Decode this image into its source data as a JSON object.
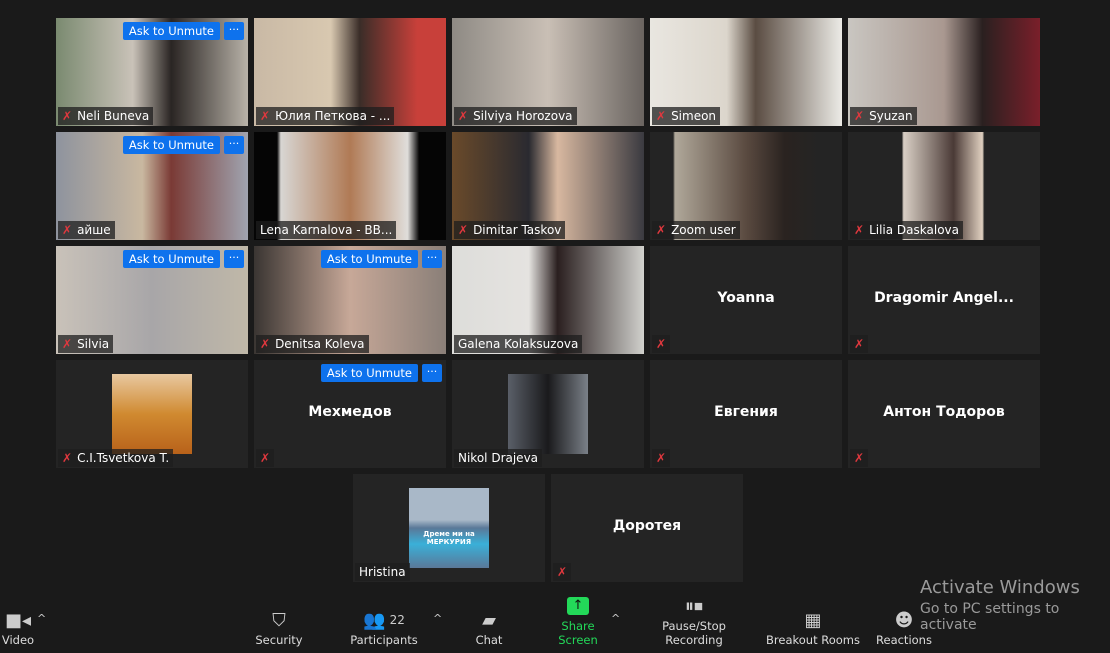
{
  "tiles": [
    {
      "name": "Neli Buneva",
      "muted": true,
      "unmute": true,
      "video": "linear-gradient(90deg,#7a8a70,#c9c2b8 40%,#2a2523 60%,#b8b2a8)"
    },
    {
      "name": "Юлия Петкова - ...",
      "muted": true,
      "video": "linear-gradient(90deg,#c9b9a5,#d8c8b0 40%,#3a2d28 55%,#c8403a 85%)"
    },
    {
      "name": "Silviya Horozova",
      "muted": true,
      "video": "linear-gradient(90deg,#8e8a84,#c9bfb5 50%,#6a6460)"
    },
    {
      "name": "Simeon",
      "muted": true,
      "video": "linear-gradient(90deg,#e9e6e0,#dcd6cc 40%,#5a4c42 55%,#ecebe6)"
    },
    {
      "name": "Syuzan",
      "muted": true,
      "video": "linear-gradient(90deg,#c9c6c1,#a99890 50%,#2a2020 70%,#7a1f2a)"
    },
    {
      "name": "айше",
      "muted": true,
      "unmute": true,
      "video": "linear-gradient(90deg,#8e939e,#c9b8a0 45%,#7a3a35 60%,#a0a4b0)"
    },
    {
      "name": "Lena Karnalova - BB...",
      "muted": false,
      "video": "linear-gradient(90deg,#050505 12%,#d8d6d3 14%,#b07a55 50%,#e0dedb 80%,#050505 86%)"
    },
    {
      "name": "Dimitar Taskov",
      "muted": true,
      "video": "linear-gradient(90deg,#6a4a2a,#2a2a30 40%,#d8b8a0 55%,#3a3a40)"
    },
    {
      "name": "Zoom user",
      "muted": true,
      "video": "linear-gradient(90deg,#242424 12%,#b0a89a 13%,#5a4a40 50%,#2a2320 70%,#242424 88%)"
    },
    {
      "name": "Lilia Daskalova",
      "muted": true,
      "video": "linear-gradient(90deg,#242424 28%,#d9cfc5 29%,#4a3a36 55%,#e0d0c0 70%,#242424 71%)"
    },
    {
      "name": "Silvia",
      "muted": true,
      "unmute": true,
      "video": "linear-gradient(90deg,#c9c2b9,#a8a6a8 50%,#c0b8a8)"
    },
    {
      "name": "Denitsa Koleva",
      "muted": true,
      "unmute": true,
      "video": "linear-gradient(90deg,#3a3532,#c7a898 50%,#8a7f78)"
    },
    {
      "name": "Galena Kolaksuzova",
      "muted": false,
      "active": true,
      "video": "linear-gradient(90deg,#ddddda,#e5e3e0 40%,#2a1f1f 55%,#d0d0cc)"
    },
    {
      "name": "",
      "bigname": "Yoanna",
      "muted": true
    },
    {
      "name": "",
      "bigname": "Dragomir  Angel...",
      "muted": true
    },
    {
      "name": "C.I.Tsvetkova T.",
      "muted": true,
      "thumb": "linear-gradient(#e8c8a0,#d08a30 50%,#b8621a)"
    },
    {
      "name": "",
      "bigname": "Мехмедов",
      "muted": true,
      "unmute": true
    },
    {
      "name": "Nikol Drajeva",
      "muted": false,
      "thumb": "linear-gradient(90deg,#5a5f68,#1a1a1c 50%,#7a8088)"
    },
    {
      "name": "",
      "bigname": "Евгения",
      "muted": true
    },
    {
      "name": "",
      "bigname": "Антон Тодоров",
      "muted": true
    },
    {
      "name": "Hristina",
      "muted": false,
      "thumb": "linear-gradient(#a9b8c8 40%,#5a7898 50%,#3ab0d8 70%,#5a7898)",
      "thumb_text": "Дреме ми на МЕРКУРИЯ"
    },
    {
      "name": "",
      "bigname": "Доротея",
      "muted": true
    }
  ],
  "labels": {
    "ask_to_unmute": "Ask to Unmute",
    "more": "···",
    "muted_icon": "✗"
  },
  "toolbar": {
    "video": "Video",
    "security": "Security",
    "participants": "Participants",
    "participant_count": "22",
    "chat": "Chat",
    "share_screen": "Share Screen",
    "recording": "Pause/Stop Recording",
    "breakout": "Breakout Rooms",
    "reactions": "Reactions"
  },
  "colors": {
    "share": "#23d959",
    "unmute": "#0e72ed",
    "muted": "#e0383e",
    "active_border": "#d6e37a"
  },
  "watermark": {
    "title": "Activate Windows",
    "subtitle": "Go to PC settings to activate"
  }
}
